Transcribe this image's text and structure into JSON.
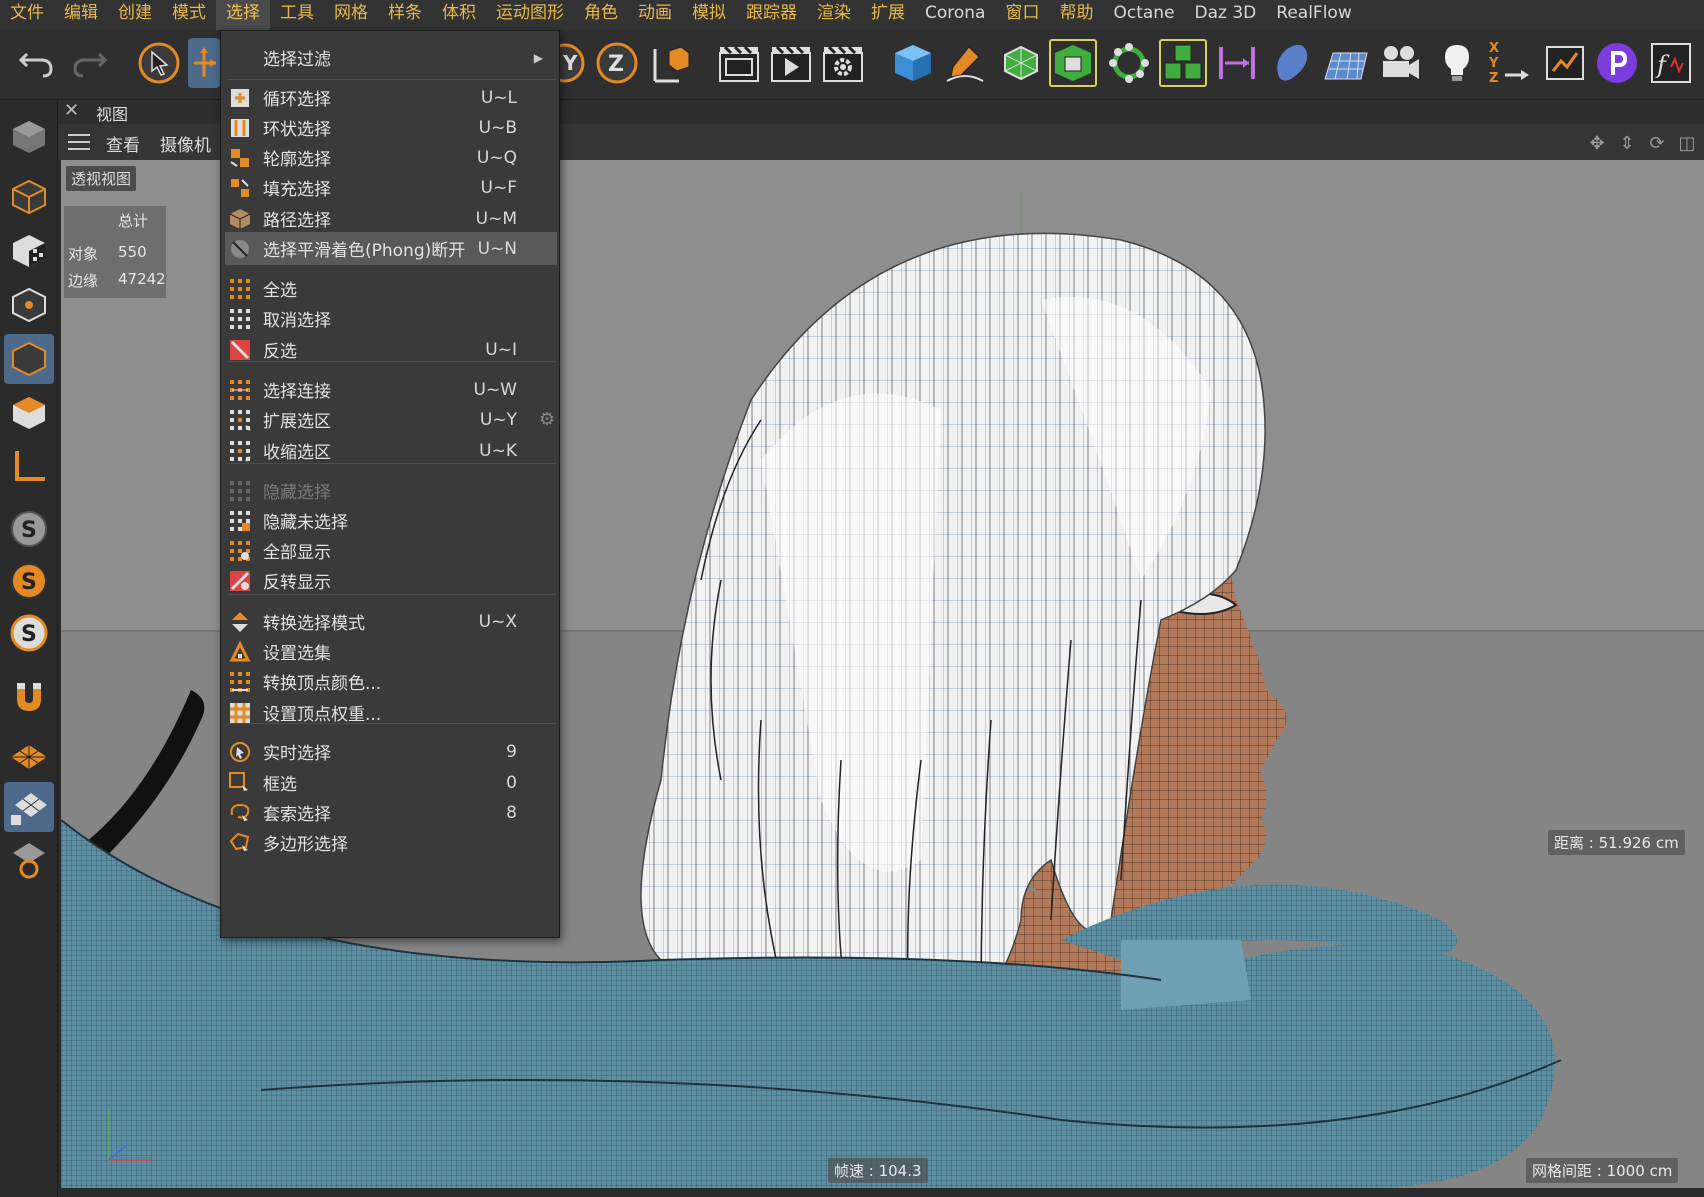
{
  "menubar": {
    "items": [
      {
        "label": "文件",
        "cjk": true
      },
      {
        "label": "编辑",
        "cjk": true
      },
      {
        "label": "创建",
        "cjk": true
      },
      {
        "label": "模式",
        "cjk": true
      },
      {
        "label": "选择",
        "cjk": true,
        "active": true
      },
      {
        "label": "工具",
        "cjk": true
      },
      {
        "label": "网格",
        "cjk": true
      },
      {
        "label": "样条",
        "cjk": true
      },
      {
        "label": "体积",
        "cjk": true
      },
      {
        "label": "运动图形",
        "cjk": true
      },
      {
        "label": "角色",
        "cjk": true
      },
      {
        "label": "动画",
        "cjk": true
      },
      {
        "label": "模拟",
        "cjk": true
      },
      {
        "label": "跟踪器",
        "cjk": true
      },
      {
        "label": "渲染",
        "cjk": true
      },
      {
        "label": "扩展",
        "cjk": true
      },
      {
        "label": "Corona",
        "cjk": false
      },
      {
        "label": "窗口",
        "cjk": true
      },
      {
        "label": "帮助",
        "cjk": true
      },
      {
        "label": "Octane",
        "cjk": false
      },
      {
        "label": "Daz 3D",
        "cjk": false
      },
      {
        "label": "RealFlow",
        "cjk": false
      }
    ]
  },
  "toolbar": {
    "icons": [
      "undo-icon",
      "redo-icon",
      "select-arrow-icon",
      "move-icon",
      "y-axis-icon",
      "z-axis-icon",
      "world-coord-icon",
      "render-region-icon",
      "render-view-icon",
      "render-settings-icon",
      "cube-icon",
      "pen-icon",
      "subdivision-icon",
      "extrude-icon",
      "mograph-cloner-icon",
      "cubes-group-icon",
      "symmetry-icon",
      "deformer-icon",
      "floor-icon",
      "camera-icon",
      "light-icon",
      "xyz-icon",
      "graph-icon",
      "plugin-icon",
      "function-icon"
    ]
  },
  "leftbar": {
    "icons": [
      "model-mode-icon",
      "object-mode-icon",
      "texture-mode-icon",
      "points-mode-icon",
      "edges-mode-icon",
      "polygons-mode-icon",
      "axis-mode-icon",
      "solo-icon",
      "solo-hierarchy-icon",
      "solo-selection-icon",
      "magnet-icon",
      "workplane-icon",
      "workplane-lock-icon",
      "workplane-snap-icon"
    ]
  },
  "viewport": {
    "tab_title": "视图",
    "menus": [
      "查看",
      "摄像机"
    ],
    "label": "透视视图",
    "stats": {
      "header": "总计",
      "row1_label": "对象",
      "row1_value": "550",
      "row2_label": "边缘",
      "row2_value": "47242"
    },
    "distance": "距离 : 51.926 cm",
    "fps": "帧速 : 104.3",
    "grid_spacing": "网格间距 : 1000 cm"
  },
  "dropdown": {
    "items": [
      {
        "label": "选择过滤",
        "key": "",
        "submenu": true,
        "icon": "none"
      },
      {
        "label": "循环选择",
        "key": "U~L",
        "icon": "loop-select-icon"
      },
      {
        "label": "环状选择",
        "key": "U~B",
        "icon": "ring-select-icon"
      },
      {
        "label": "轮廓选择",
        "key": "U~Q",
        "icon": "outline-select-icon"
      },
      {
        "label": "填充选择",
        "key": "U~F",
        "icon": "fill-select-icon"
      },
      {
        "label": "路径选择",
        "key": "U~M",
        "icon": "path-select-icon"
      },
      {
        "label": "选择平滑着色(Phong)断开",
        "key": "U~N",
        "icon": "phong-break-icon",
        "active": true
      },
      {
        "label": "全选",
        "key": "",
        "icon": "select-all-icon"
      },
      {
        "label": "取消选择",
        "key": "",
        "icon": "deselect-icon"
      },
      {
        "label": "反选",
        "key": "U~I",
        "icon": "invert-select-icon"
      },
      {
        "label": "选择连接",
        "key": "U~W",
        "icon": "select-connected-icon"
      },
      {
        "label": "扩展选区",
        "key": "U~Y",
        "icon": "grow-select-icon",
        "gear": true
      },
      {
        "label": "收缩选区",
        "key": "U~K",
        "icon": "shrink-select-icon"
      },
      {
        "label": "隐藏选择",
        "key": "",
        "icon": "hide-selected-icon",
        "disabled": true
      },
      {
        "label": "隐藏未选择",
        "key": "",
        "icon": "hide-unselected-icon"
      },
      {
        "label": "全部显示",
        "key": "",
        "icon": "unhide-all-icon"
      },
      {
        "label": "反转显示",
        "key": "",
        "icon": "invert-visibility-icon"
      },
      {
        "label": "转换选择模式",
        "key": "U~X",
        "icon": "convert-selection-icon"
      },
      {
        "label": "设置选集",
        "key": "",
        "icon": "set-selection-icon"
      },
      {
        "label": "转换顶点颜色...",
        "key": "",
        "icon": "vertex-color-icon"
      },
      {
        "label": "设置顶点权重...",
        "key": "",
        "icon": "vertex-weight-icon"
      },
      {
        "label": "实时选择",
        "key": "9",
        "icon": "live-select-icon"
      },
      {
        "label": "框选",
        "key": "0",
        "icon": "rect-select-icon"
      },
      {
        "label": "套索选择",
        "key": "8",
        "icon": "lasso-select-icon"
      },
      {
        "label": "多边形选择",
        "key": "",
        "icon": "polygon-select-icon"
      }
    ]
  }
}
